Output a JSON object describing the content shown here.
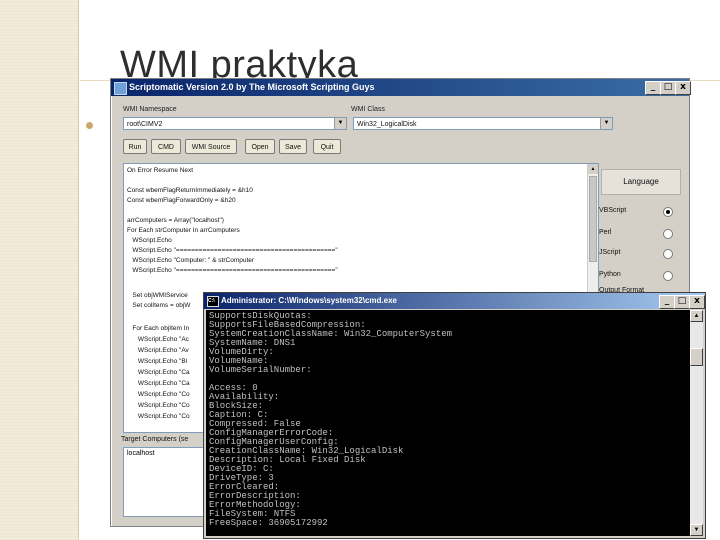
{
  "slide": {
    "title": "WMI praktyka"
  },
  "scriptomatic": {
    "title": "Scriptomatic Version 2.0 by The Microsoft Scripting Guys",
    "controls": {
      "minimize": "_",
      "maximize": "□",
      "close": "x"
    },
    "namespace_label": "WMI Namespace",
    "namespace_value": "root\\CIMV2",
    "class_label": "WMI Class",
    "class_value": "Win32_LogicalDisk",
    "buttons": [
      "Run",
      "CMD",
      "WMI Source",
      "Open",
      "Save",
      "Quit"
    ],
    "code_lines": [
      "On Error Resume Next",
      "",
      "Const wbemFlagReturnImmediately = &h10",
      "Const wbemFlagForwardOnly = &h20",
      "",
      "arrComputers = Array(\"localhost\")",
      "For Each strComputer In arrComputers",
      "   WScript.Echo",
      "   WScript.Echo \"==========================================\"",
      "   WScript.Echo \"Computer: \" & strComputer",
      "   WScript.Echo \"==========================================\"",
      "",
      "   Set objWMIService",
      "   Set colItems = objW",
      "",
      "   For Each objItem In",
      "      WScript.Echo \"Ac",
      "      WScript.Echo \"Av",
      "      WScript.Echo \"Bl",
      "      WScript.Echo \"Ca",
      "      WScript.Echo \"Ca",
      "      WScript.Echo \"Co",
      "      WScript.Echo \"Co",
      "      WScript.Echo \"Co"
    ],
    "language": {
      "title": "Language",
      "options": [
        {
          "label": "VBScript",
          "selected": true
        },
        {
          "label": "Perl",
          "selected": false
        },
        {
          "label": "JScript",
          "selected": false
        },
        {
          "label": "Python",
          "selected": false
        }
      ]
    },
    "output_format_label": "Output Format",
    "target_label": "Target Computers (se",
    "target_value": "localhost"
  },
  "cmd": {
    "title": "Administrator: C:\\Windows\\system32\\cmd.exe",
    "controls": {
      "minimize": "_",
      "maximize": "□",
      "close": "x"
    },
    "lines": [
      "SupportsDiskQuotas:",
      "SupportsFileBasedCompression:",
      "SystemCreationClassName: Win32_ComputerSystem",
      "SystemName: DNS1",
      "VolumeDirty:",
      "VolumeName:",
      "VolumeSerialNumber:",
      "",
      "Access: 0",
      "Availability:",
      "BlockSize:",
      "Caption: C:",
      "Compressed: False",
      "ConfigManagerErrorCode:",
      "ConfigManagerUserConfig:",
      "CreationClassName: Win32_LogicalDisk",
      "Description: Local Fixed Disk",
      "DeviceID: C:",
      "DriveType: 3",
      "ErrorCleared:",
      "ErrorDescription:",
      "ErrorMethodology:",
      "FileSystem: NTFS",
      "FreeSpace: 36905172992"
    ]
  }
}
